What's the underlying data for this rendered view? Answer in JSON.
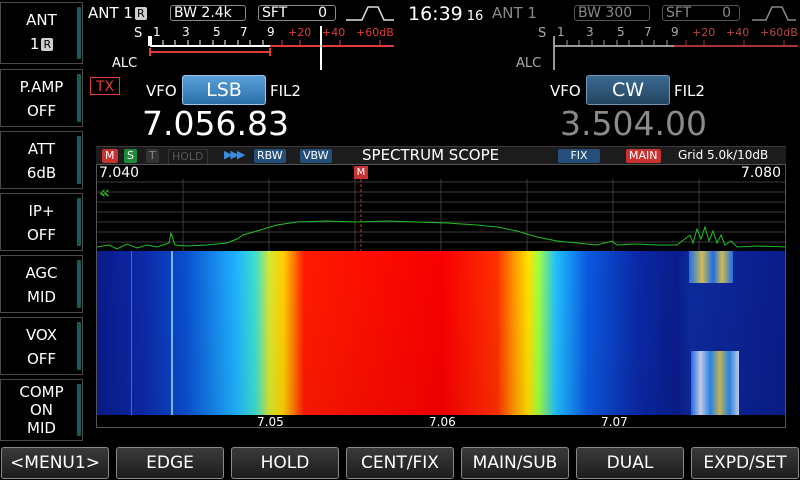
{
  "sidebar": [
    {
      "top": "ANT",
      "bottom": "1",
      "badge": "R"
    },
    {
      "top": "P.AMP",
      "bottom": "OFF"
    },
    {
      "top": "ATT",
      "bottom": "6dB"
    },
    {
      "top": "IP+",
      "bottom": "OFF"
    },
    {
      "top": "AGC",
      "bottom": "MID"
    },
    {
      "top": "VOX",
      "bottom": "OFF"
    },
    {
      "top": "COMP",
      "mid": "ON",
      "bottom": "MID"
    }
  ],
  "main": {
    "ant": "ANT 1",
    "ant_badge": "R",
    "bw_label": "BW",
    "bw_value": "2.4k",
    "sft_label": "SFT",
    "sft_value": "0",
    "mode": "LSB",
    "vfo": "VFO",
    "fil": "FIL2",
    "frequency": "7.056.83",
    "tx": "TX",
    "alc": "ALC"
  },
  "sub": {
    "ant": "ANT 1",
    "bw_label": "BW",
    "bw_value": "300",
    "sft_label": "SFT",
    "sft_value": "0",
    "mode": "CW",
    "vfo": "VFO",
    "fil": "FIL2",
    "frequency": "3.504.00",
    "alc": "ALC"
  },
  "clock": {
    "time": "16:39",
    "seconds": "16"
  },
  "meter": {
    "s": "S",
    "marks": [
      "1",
      "3",
      "5",
      "7",
      "9"
    ],
    "plus": [
      "+20",
      "+40",
      "+60dB"
    ]
  },
  "scope": {
    "title": "SPECTRUM SCOPE",
    "m": "M",
    "s": "S",
    "t": "T",
    "hold": "HOLD",
    "rbw": "RBW",
    "vbw": "VBW",
    "fix": "FIX",
    "main": "MAIN",
    "grid": "Grid 5.0k/10dB",
    "left_freq": "7.040",
    "right_freq": "7.080",
    "marker": "M",
    "arrow": "«",
    "ticks": [
      "7.05",
      "7.06",
      "7.07"
    ]
  },
  "buttons": [
    "<MENU1>",
    "EDGE",
    "HOLD",
    "CENT/FIX",
    "MAIN/SUB",
    "DUAL",
    "EXPD/SET"
  ],
  "colors": {
    "accent": "#2aa7a0",
    "button_blue": "#2b6fa8",
    "red": "#e03a3a",
    "green": "#22c022"
  }
}
